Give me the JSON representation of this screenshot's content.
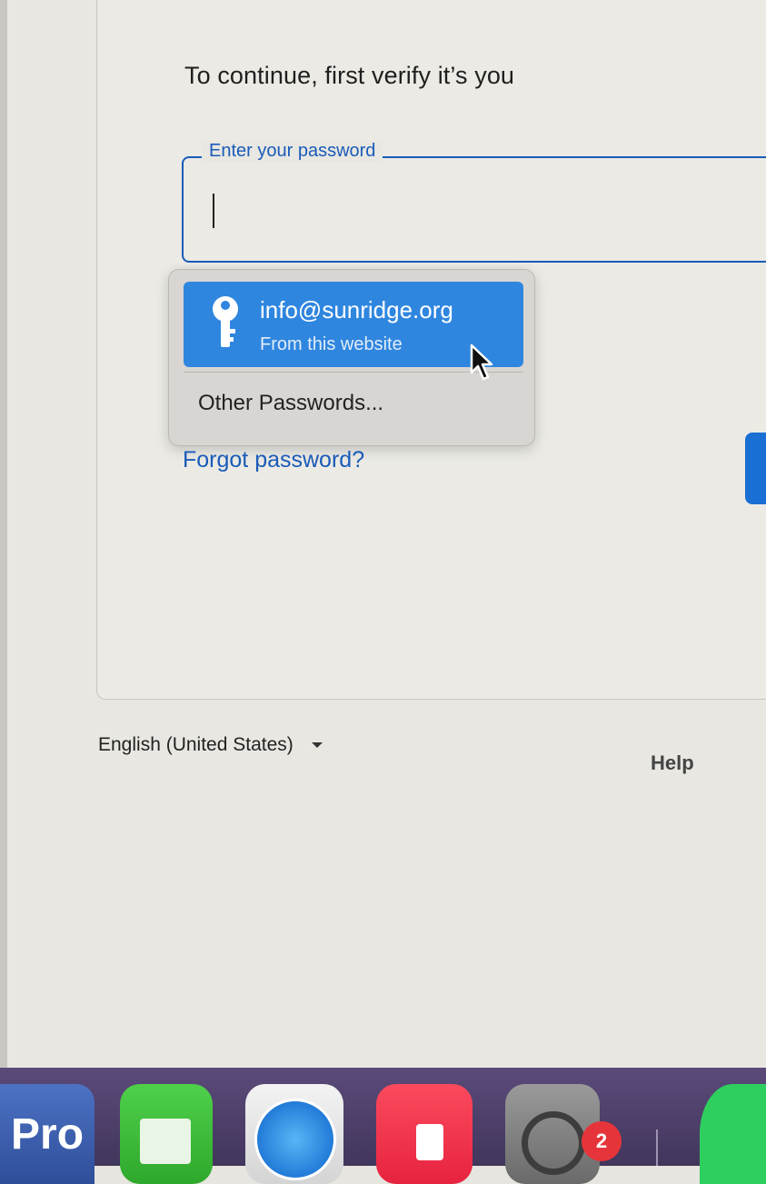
{
  "signin": {
    "heading": "To continue, first verify it’s you",
    "password_label": "Enter your password",
    "password_value": "",
    "forgot_link": "Forgot password?"
  },
  "autofill": {
    "suggestion_email": "info@sunridge.org",
    "suggestion_source": "From this website",
    "other_passwords": "Other Passwords..."
  },
  "footer": {
    "language": "English (United States)",
    "help": "Help"
  },
  "dock": {
    "pro_label": "Pro",
    "settings_badge": "2"
  },
  "colors": {
    "accent_blue": "#1a5bb8",
    "autofill_highlight": "#2f86df",
    "badge_red": "#e6353a"
  }
}
